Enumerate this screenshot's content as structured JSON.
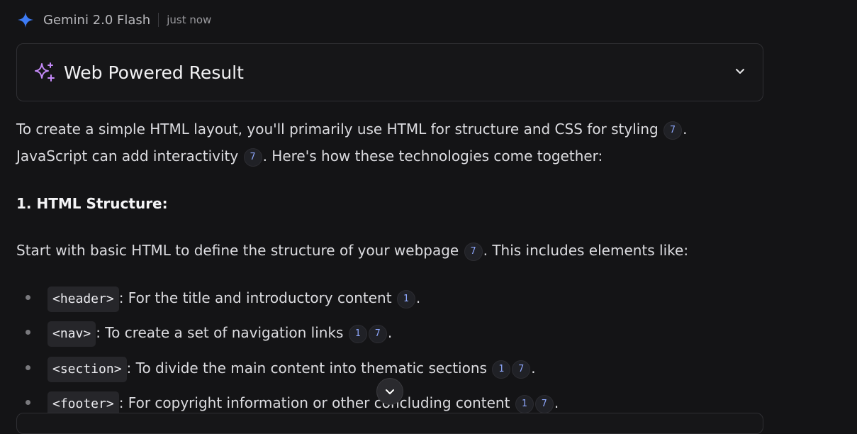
{
  "header": {
    "model": "Gemini 2.0 Flash",
    "time": "just now"
  },
  "card": {
    "title": "Web Powered Result"
  },
  "para1": {
    "line1": "To create a simple HTML layout, you'll primarily use HTML for structure and CSS for styling",
    "cite1": "7",
    "end1": ".",
    "line2": "JavaScript can add interactivity",
    "cite2": "7",
    "end2": ". Here's how these technologies come together:"
  },
  "section1": {
    "heading": "1. HTML Structure:"
  },
  "para2": {
    "text": "Start with basic HTML to define the structure of your webpage",
    "cite": "7",
    "end": ". This includes elements like:"
  },
  "list": [
    {
      "code": "<header>",
      "text": ": For the title and introductory content",
      "cites": [
        "1"
      ],
      "end": "."
    },
    {
      "code": "<nav>",
      "text": ": To create a set of navigation links",
      "cites": [
        "1",
        "7"
      ],
      "end": "."
    },
    {
      "code": "<section>",
      "text": ": To divide the main content into thematic sections",
      "cites": [
        "1",
        "7"
      ],
      "end": "."
    },
    {
      "code": "<footer>",
      "text": ": For copyright information or other concluding content",
      "cites": [
        "1",
        "7"
      ],
      "end": "."
    }
  ],
  "icons": {
    "gemini": "gemini-spark-icon",
    "card": "sparkles-icon",
    "expand": "chevron-down-icon",
    "scroll": "chevron-down-icon"
  },
  "colors": {
    "accent": "#3d7bf5",
    "sparkle": "#c58af9",
    "cite": "#8fa8ff"
  }
}
